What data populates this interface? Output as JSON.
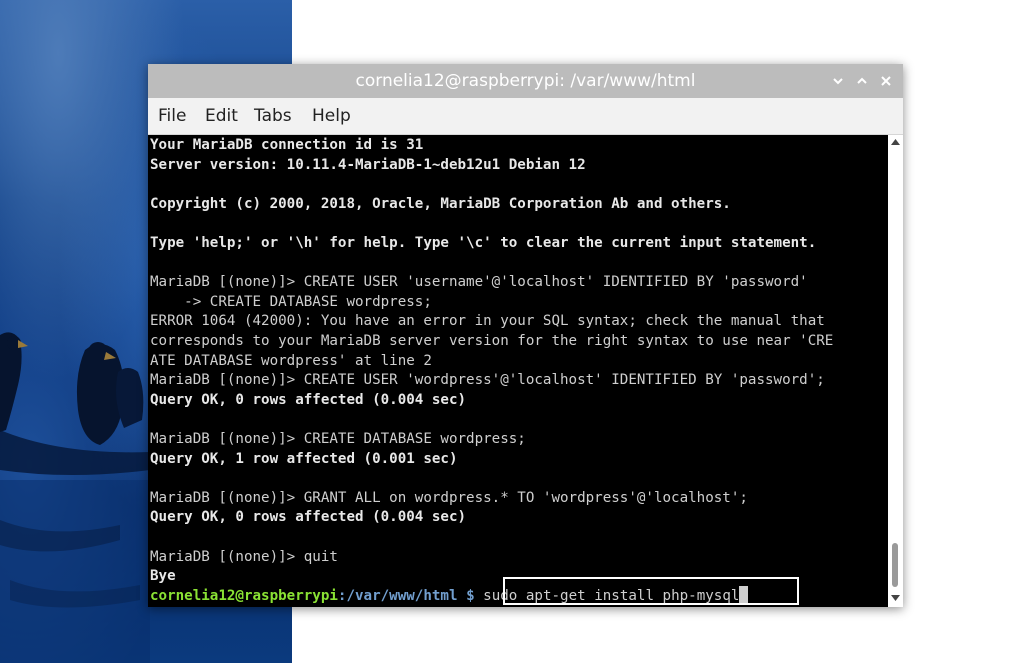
{
  "window": {
    "title": "cornelia12@raspberrypi: /var/www/html",
    "controls": {
      "minimize_icon": "chevron-down-icon",
      "maximize_icon": "chevron-up-icon",
      "close_icon": "close-icon"
    }
  },
  "menubar": {
    "items": [
      {
        "label": "File"
      },
      {
        "label": "Edit"
      },
      {
        "label": "Tabs"
      },
      {
        "label": "Help"
      }
    ]
  },
  "terminal": {
    "lines": [
      {
        "text": "Your MariaDB connection id is 31",
        "style": "bold"
      },
      {
        "text": "Server version: 10.11.4-MariaDB-1~deb12u1 Debian 12",
        "style": "bold"
      },
      {
        "text": "",
        "style": "normal"
      },
      {
        "text": "Copyright (c) 2000, 2018, Oracle, MariaDB Corporation Ab and others.",
        "style": "bold"
      },
      {
        "text": "",
        "style": "normal"
      },
      {
        "text": "Type 'help;' or '\\h' for help. Type '\\c' to clear the current input statement.",
        "style": "bold"
      },
      {
        "text": "",
        "style": "normal"
      },
      {
        "text": "MariaDB [(none)]> CREATE USER 'username'@'localhost' IDENTIFIED BY 'password'",
        "style": "normal"
      },
      {
        "text": "    -> CREATE DATABASE wordpress;",
        "style": "normal"
      },
      {
        "text": "ERROR 1064 (42000): You have an error in your SQL syntax; check the manual that",
        "style": "normal"
      },
      {
        "text": "corresponds to your MariaDB server version for the right syntax to use near 'CRE",
        "style": "normal"
      },
      {
        "text": "ATE DATABASE wordpress' at line 2",
        "style": "normal"
      },
      {
        "text": "MariaDB [(none)]> CREATE USER 'wordpress'@'localhost' IDENTIFIED BY 'password';",
        "style": "normal"
      },
      {
        "text": "Query OK, 0 rows affected (0.004 sec)",
        "style": "bold"
      },
      {
        "text": "",
        "style": "normal"
      },
      {
        "text": "MariaDB [(none)]> CREATE DATABASE wordpress;",
        "style": "normal"
      },
      {
        "text": "Query OK, 1 row affected (0.001 sec)",
        "style": "bold"
      },
      {
        "text": "",
        "style": "normal"
      },
      {
        "text": "MariaDB [(none)]> GRANT ALL on wordpress.* TO 'wordpress'@'localhost';",
        "style": "normal"
      },
      {
        "text": "Query OK, 0 rows affected (0.004 sec)",
        "style": "bold"
      },
      {
        "text": "",
        "style": "normal"
      },
      {
        "text": "MariaDB [(none)]> quit",
        "style": "normal"
      },
      {
        "text": "Bye",
        "style": "bold"
      }
    ],
    "prompt": {
      "user_host": "cornelia12@raspberrypi",
      "separator": ":",
      "path": "/var/www/html",
      "symbol": "$",
      "command": "sudo apt-get install php-mysql"
    }
  },
  "colors": {
    "titlebar": "#bcbcbc",
    "menubar": "#f2f2f2",
    "terminal_bg": "#000000",
    "terminal_fg": "#cfcfcf",
    "prompt_user": "#8ae234",
    "prompt_path": "#729fcf",
    "highlight_border": "#ffffff"
  }
}
